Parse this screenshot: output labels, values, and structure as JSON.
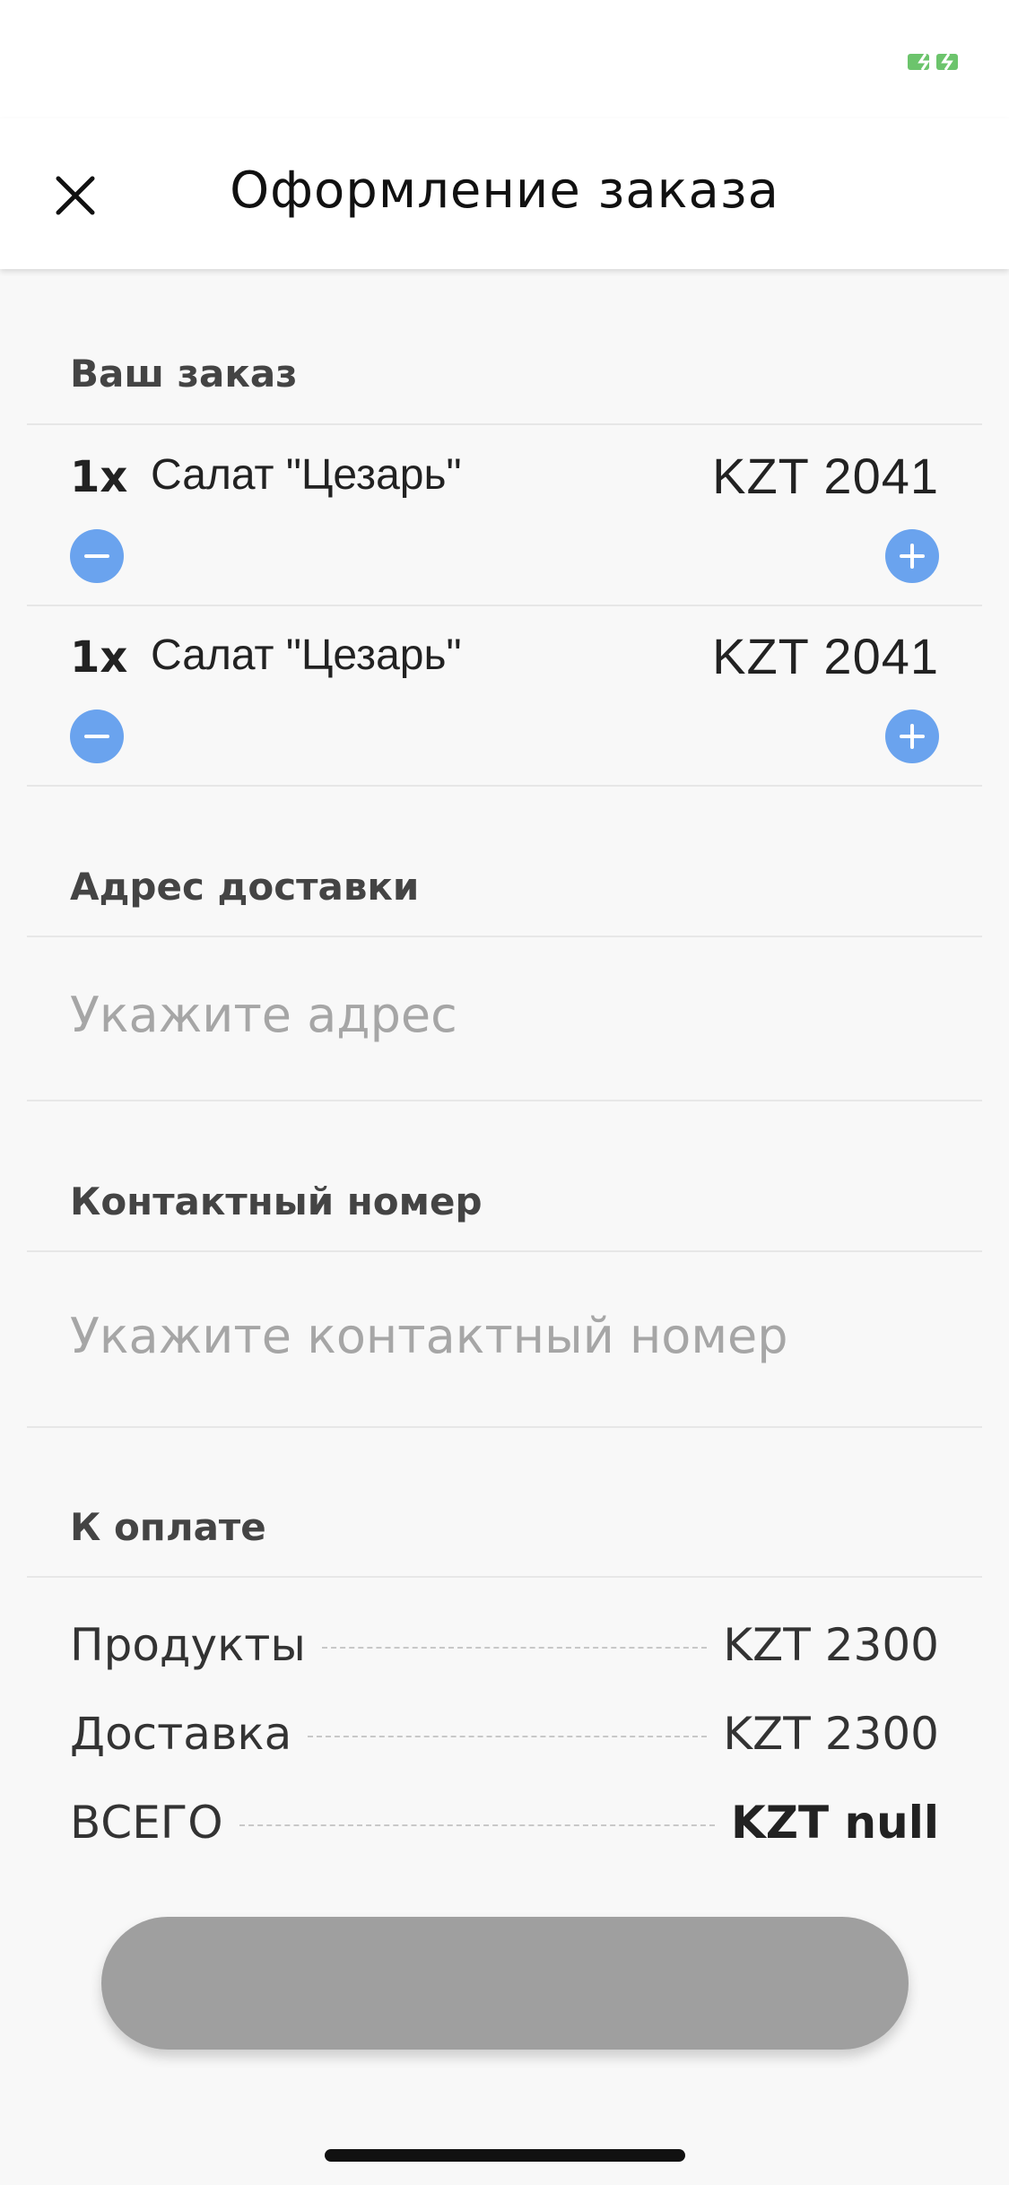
{
  "header": {
    "title": "Оформление заказа",
    "close_icon": "close-icon"
  },
  "order": {
    "section_title": "Ваш заказ",
    "items": [
      {
        "qty": "1x",
        "name": "Салат \"Цезарь\"",
        "price": "KZT 2041"
      },
      {
        "qty": "1x",
        "name": "Салат \"Цезарь\"",
        "price": "KZT 2041"
      }
    ]
  },
  "address": {
    "section_title": "Адрес доставки",
    "placeholder": "Укажите адрес"
  },
  "contact": {
    "section_title": "Контактный номер",
    "placeholder": "Укажите контактный номер"
  },
  "payment": {
    "section_title": "К оплате",
    "rows": [
      {
        "label": "Продукты",
        "value": "KZT 2300"
      },
      {
        "label": "Доставка",
        "value": "KZT 2300"
      },
      {
        "label": "ВСЕГО",
        "value": "KZT null"
      }
    ]
  },
  "colors": {
    "accent_blue": "#6aa3ee",
    "button_gray": "#9f9f9f",
    "battery_green": "#6cc46c"
  }
}
